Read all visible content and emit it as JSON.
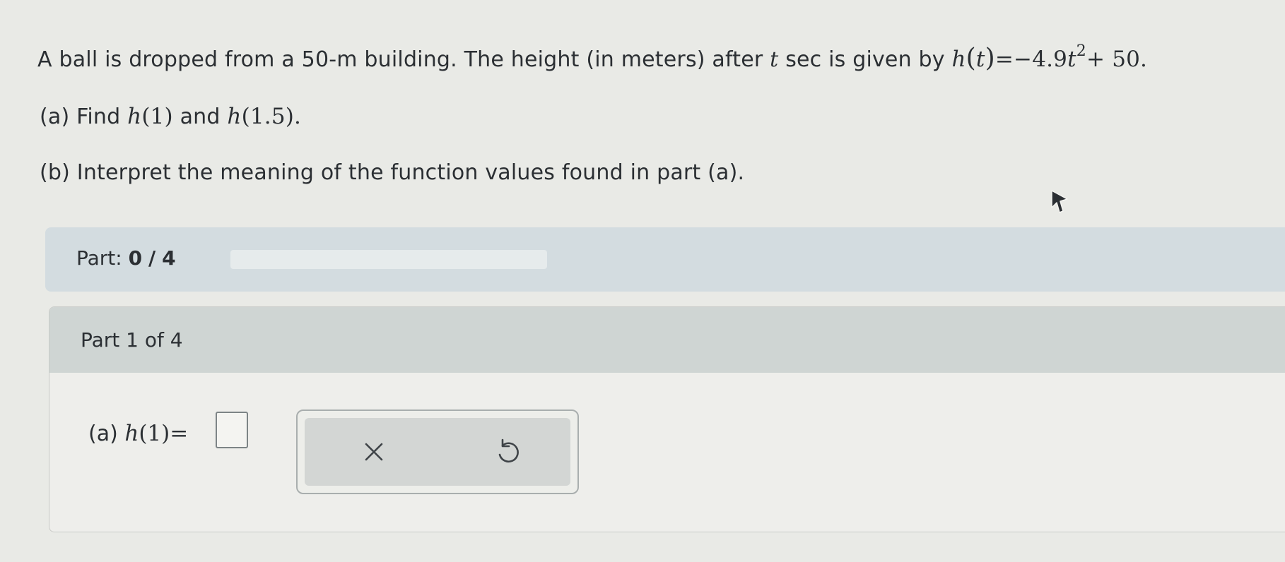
{
  "problem": {
    "intro_text": "A ball is dropped from a 50-m building. The height (in meters) after",
    "var_t": "t",
    "intro_text_2": "sec is given by",
    "func_name": "h",
    "func_arg_open": "(",
    "func_arg": "t",
    "func_arg_close": ")",
    "equals_rhs": "=−4.9",
    "rhs_var": "t",
    "rhs_exp": "2",
    "rhs_tail": "+ 50.",
    "part_a_prefix": "(a) Find",
    "part_a_f1_name": "h",
    "part_a_f1_arg": "(1)",
    "part_a_and": "and",
    "part_a_f2_name": "h",
    "part_a_f2_arg": "(1.5).",
    "part_b_text": "(b) Interpret the meaning of the function values found in part (a)."
  },
  "progress": {
    "label": "Part:",
    "current": "0",
    "separator": "/",
    "total": "4",
    "fraction": 0.0,
    "fill_color": "#3a8a5c"
  },
  "panel": {
    "header": "Part 1 of 4",
    "question_prefix": "(a)",
    "question_func": "h",
    "question_arg": "(1)",
    "question_equals": "=",
    "answer_value": ""
  },
  "actions": {
    "clear_icon": "close-icon",
    "undo_icon": "undo-icon"
  }
}
